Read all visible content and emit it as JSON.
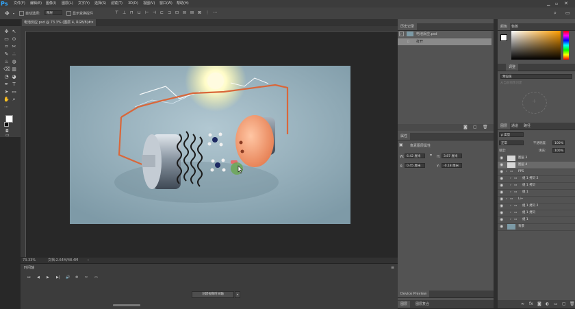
{
  "app": {
    "logo": "Ps",
    "accent": "#31a8ff",
    "bg": "#282828"
  },
  "menu": [
    "文件(F)",
    "编辑(E)",
    "图像(I)",
    "图层(L)",
    "文字(Y)",
    "选择(S)",
    "滤镜(T)",
    "3D(D)",
    "视图(V)",
    "窗口(W)",
    "帮助(H)"
  ],
  "options": {
    "auto_select": "自动选择:",
    "auto_select_value": "图层",
    "show_transform": "显示变换控件"
  },
  "document": {
    "tab_title": "电池反应.psd @ 73.3% (图层 4, RGB/8)#",
    "zoom": "73.33%",
    "status_text": "文档:2.64M/48.4M"
  },
  "timeline": {
    "title": "时间轴",
    "create_button": "创建视频时间轴"
  },
  "history": {
    "tab": "历史记录",
    "snapshot": "电池反应.psd",
    "items": [
      "打开"
    ]
  },
  "properties": {
    "tab": "属性",
    "subtitle": "像素图层属性",
    "w_label": "W:",
    "w_value": "6.42 厘米",
    "h_label": "H:",
    "h_value": "3.87 厘米",
    "x_label": "X:",
    "x_value": "0.45 厘米",
    "y_label": "Y:",
    "y_value": "-0.18 厘米",
    "link_icon": "link-icon"
  },
  "device_preview": {
    "tab1": "Device Preview",
    "footer1": "图层",
    "footer2": "图层复合"
  },
  "color": {
    "tab1": "颜色",
    "tab2": "色板",
    "fg": "#ffffff",
    "bg": "#000000"
  },
  "adjustments": {
    "tab": "调整",
    "dropdown": "预设值",
    "dropdown2": "从当前图像创建"
  },
  "layers": {
    "tabs": [
      "图层",
      "通道",
      "路径"
    ],
    "filter_label": "ρ 类型",
    "blend_mode": "正常",
    "opacity_label": "不透明度:",
    "opacity_value": "100%",
    "lock_label": "锁定:",
    "fill_label": "填充:",
    "fill_value": "100%",
    "rows": [
      {
        "name": "图层 3",
        "indent": 0,
        "kind": "layer"
      },
      {
        "name": "图层 4",
        "indent": 0,
        "kind": "layer"
      },
      {
        "name": "PPS",
        "indent": 0,
        "kind": "group"
      },
      {
        "name": "组 1 拷贝 2",
        "indent": 1,
        "kind": "group"
      },
      {
        "name": "组 1 拷贝",
        "indent": 1,
        "kind": "group"
      },
      {
        "name": "组 1",
        "indent": 1,
        "kind": "group"
      },
      {
        "name": "Li+",
        "indent": 0,
        "kind": "group"
      },
      {
        "name": "组 1 拷贝 2",
        "indent": 1,
        "kind": "group"
      },
      {
        "name": "组 1 拷贝",
        "indent": 1,
        "kind": "group"
      },
      {
        "name": "组 1",
        "indent": 1,
        "kind": "group"
      },
      {
        "name": "背景",
        "indent": 0,
        "kind": "background"
      }
    ]
  }
}
